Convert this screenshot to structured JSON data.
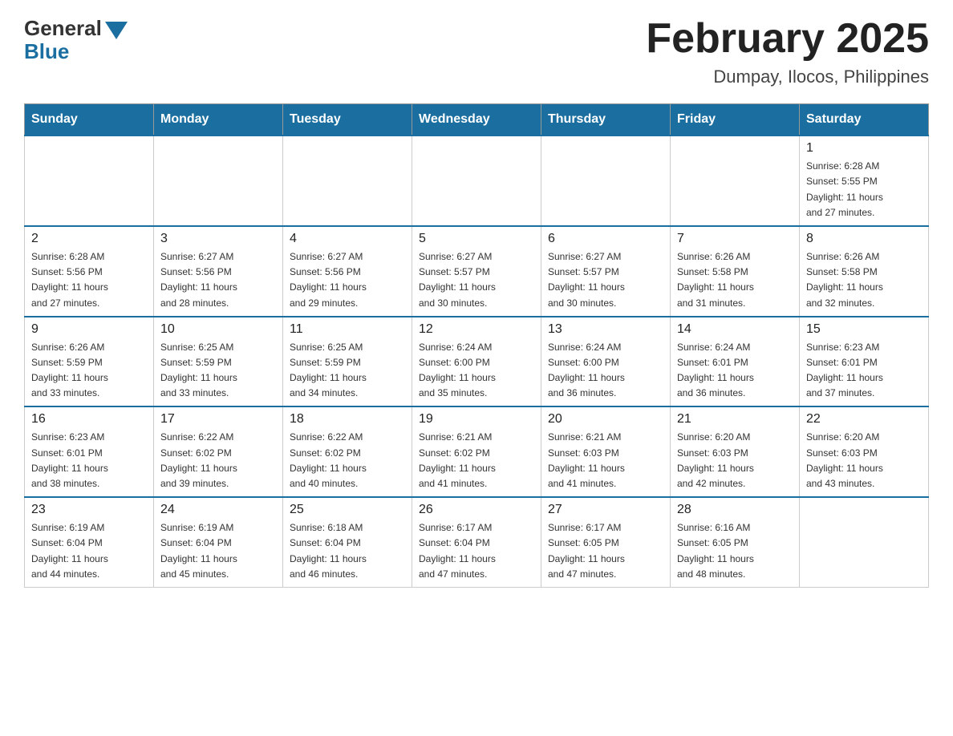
{
  "header": {
    "logo_general": "General",
    "logo_blue": "Blue",
    "month_title": "February 2025",
    "location": "Dumpay, Ilocos, Philippines"
  },
  "weekdays": [
    "Sunday",
    "Monday",
    "Tuesday",
    "Wednesday",
    "Thursday",
    "Friday",
    "Saturday"
  ],
  "weeks": [
    [
      {
        "day": "",
        "info": ""
      },
      {
        "day": "",
        "info": ""
      },
      {
        "day": "",
        "info": ""
      },
      {
        "day": "",
        "info": ""
      },
      {
        "day": "",
        "info": ""
      },
      {
        "day": "",
        "info": ""
      },
      {
        "day": "1",
        "info": "Sunrise: 6:28 AM\nSunset: 5:55 PM\nDaylight: 11 hours\nand 27 minutes."
      }
    ],
    [
      {
        "day": "2",
        "info": "Sunrise: 6:28 AM\nSunset: 5:56 PM\nDaylight: 11 hours\nand 27 minutes."
      },
      {
        "day": "3",
        "info": "Sunrise: 6:27 AM\nSunset: 5:56 PM\nDaylight: 11 hours\nand 28 minutes."
      },
      {
        "day": "4",
        "info": "Sunrise: 6:27 AM\nSunset: 5:56 PM\nDaylight: 11 hours\nand 29 minutes."
      },
      {
        "day": "5",
        "info": "Sunrise: 6:27 AM\nSunset: 5:57 PM\nDaylight: 11 hours\nand 30 minutes."
      },
      {
        "day": "6",
        "info": "Sunrise: 6:27 AM\nSunset: 5:57 PM\nDaylight: 11 hours\nand 30 minutes."
      },
      {
        "day": "7",
        "info": "Sunrise: 6:26 AM\nSunset: 5:58 PM\nDaylight: 11 hours\nand 31 minutes."
      },
      {
        "day": "8",
        "info": "Sunrise: 6:26 AM\nSunset: 5:58 PM\nDaylight: 11 hours\nand 32 minutes."
      }
    ],
    [
      {
        "day": "9",
        "info": "Sunrise: 6:26 AM\nSunset: 5:59 PM\nDaylight: 11 hours\nand 33 minutes."
      },
      {
        "day": "10",
        "info": "Sunrise: 6:25 AM\nSunset: 5:59 PM\nDaylight: 11 hours\nand 33 minutes."
      },
      {
        "day": "11",
        "info": "Sunrise: 6:25 AM\nSunset: 5:59 PM\nDaylight: 11 hours\nand 34 minutes."
      },
      {
        "day": "12",
        "info": "Sunrise: 6:24 AM\nSunset: 6:00 PM\nDaylight: 11 hours\nand 35 minutes."
      },
      {
        "day": "13",
        "info": "Sunrise: 6:24 AM\nSunset: 6:00 PM\nDaylight: 11 hours\nand 36 minutes."
      },
      {
        "day": "14",
        "info": "Sunrise: 6:24 AM\nSunset: 6:01 PM\nDaylight: 11 hours\nand 36 minutes."
      },
      {
        "day": "15",
        "info": "Sunrise: 6:23 AM\nSunset: 6:01 PM\nDaylight: 11 hours\nand 37 minutes."
      }
    ],
    [
      {
        "day": "16",
        "info": "Sunrise: 6:23 AM\nSunset: 6:01 PM\nDaylight: 11 hours\nand 38 minutes."
      },
      {
        "day": "17",
        "info": "Sunrise: 6:22 AM\nSunset: 6:02 PM\nDaylight: 11 hours\nand 39 minutes."
      },
      {
        "day": "18",
        "info": "Sunrise: 6:22 AM\nSunset: 6:02 PM\nDaylight: 11 hours\nand 40 minutes."
      },
      {
        "day": "19",
        "info": "Sunrise: 6:21 AM\nSunset: 6:02 PM\nDaylight: 11 hours\nand 41 minutes."
      },
      {
        "day": "20",
        "info": "Sunrise: 6:21 AM\nSunset: 6:03 PM\nDaylight: 11 hours\nand 41 minutes."
      },
      {
        "day": "21",
        "info": "Sunrise: 6:20 AM\nSunset: 6:03 PM\nDaylight: 11 hours\nand 42 minutes."
      },
      {
        "day": "22",
        "info": "Sunrise: 6:20 AM\nSunset: 6:03 PM\nDaylight: 11 hours\nand 43 minutes."
      }
    ],
    [
      {
        "day": "23",
        "info": "Sunrise: 6:19 AM\nSunset: 6:04 PM\nDaylight: 11 hours\nand 44 minutes."
      },
      {
        "day": "24",
        "info": "Sunrise: 6:19 AM\nSunset: 6:04 PM\nDaylight: 11 hours\nand 45 minutes."
      },
      {
        "day": "25",
        "info": "Sunrise: 6:18 AM\nSunset: 6:04 PM\nDaylight: 11 hours\nand 46 minutes."
      },
      {
        "day": "26",
        "info": "Sunrise: 6:17 AM\nSunset: 6:04 PM\nDaylight: 11 hours\nand 47 minutes."
      },
      {
        "day": "27",
        "info": "Sunrise: 6:17 AM\nSunset: 6:05 PM\nDaylight: 11 hours\nand 47 minutes."
      },
      {
        "day": "28",
        "info": "Sunrise: 6:16 AM\nSunset: 6:05 PM\nDaylight: 11 hours\nand 48 minutes."
      },
      {
        "day": "",
        "info": ""
      }
    ]
  ]
}
